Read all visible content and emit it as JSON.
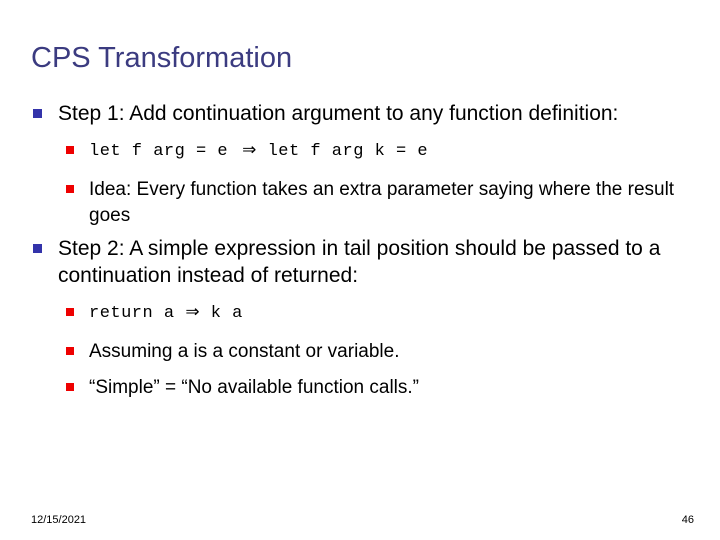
{
  "slide": {
    "title": "CPS Transformation",
    "colors": {
      "title": "#3b3b80",
      "level1_bullet": "#3333aa",
      "level2_bullet": "#ee0000",
      "text": "#000000",
      "background": "#ffffff"
    },
    "content": [
      {
        "level": 1,
        "text": "Step 1: Add continuation argument to any function definition:"
      },
      {
        "level": 2,
        "style": "monospace",
        "text": "let f arg = e",
        "arrow": "⇒",
        "text_after": "let f arg k = e"
      },
      {
        "level": 2,
        "style": "normal",
        "text": "Idea: Every function takes an extra parameter saying where the result goes"
      },
      {
        "level": 1,
        "text": "Step 2: A simple expression in tail position should be passed to a continuation instead of returned:"
      },
      {
        "level": 2,
        "style": "monospace",
        "text": "return a",
        "arrow": "⇒",
        "text_after": "k a"
      },
      {
        "level": 2,
        "style": "normal",
        "text": "Assuming a is a constant or variable."
      },
      {
        "level": 2,
        "style": "normal",
        "text": "“Simple” = “No available function calls.”"
      }
    ],
    "footer": {
      "date": "12/15/2021",
      "page_number": "46"
    }
  }
}
